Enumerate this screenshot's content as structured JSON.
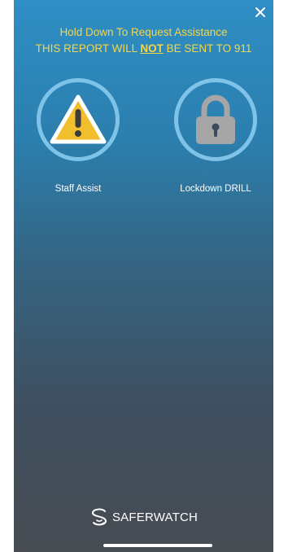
{
  "header": {
    "line1": "Hold Down To Request Assistance",
    "line2_before": "THIS REPORT WILL ",
    "line2_emphasis": "NOT",
    "line2_after": " BE SENT TO 911"
  },
  "actions": [
    {
      "label": "Staff Assist",
      "icon": "warning-icon"
    },
    {
      "label": "Lockdown DRILL",
      "icon": "lock-icon"
    }
  ],
  "brand": {
    "name": "SAFERWATCH"
  },
  "colors": {
    "header_text": "#f4d64a",
    "ring": "#7fc3e8",
    "warning_fill": "#f1bf2e",
    "lock_fill": "#a6a6a6"
  },
  "icons": {
    "close": "close-icon",
    "brand_logo": "saferwatch-logo-icon"
  }
}
